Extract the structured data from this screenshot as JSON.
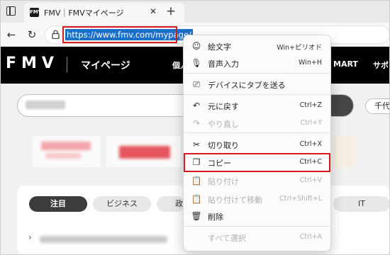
{
  "browser": {
    "tab": {
      "favicon_text": "FMV",
      "title": "FMV｜FMVマイページ",
      "close": "✕"
    },
    "new_tab": "+",
    "nav": {
      "back": "←",
      "reload": "↻"
    },
    "address": {
      "url": "https://www.fmv.com/mypage/"
    }
  },
  "page": {
    "logo": "FMV",
    "title": "マイページ",
    "nav": [
      "個人",
      "MART",
      "サポ"
    ],
    "location_chip": "千代",
    "tabs": [
      "注目",
      "ビジネス",
      "政",
      "IT"
    ],
    "list_chevron": "›"
  },
  "context_menu": {
    "items": [
      {
        "icon": "emoji-icon",
        "glyph": "☺",
        "label": "絵文字",
        "shortcut": "Win+ピリオド",
        "disabled": false
      },
      {
        "icon": "microphone-icon",
        "glyph": "🎙",
        "label": "音声入力",
        "shortcut": "Win+H",
        "disabled": false
      },
      {
        "icon": "send-to-device-icon",
        "glyph": "⎚",
        "label": "デバイスにタブを送る",
        "shortcut": "",
        "disabled": false
      },
      {
        "icon": "undo-icon",
        "glyph": "↶",
        "label": "元に戻す",
        "shortcut": "Ctrl+Z",
        "disabled": false
      },
      {
        "icon": "redo-icon",
        "glyph": "↷",
        "label": "やり直し",
        "shortcut": "Ctrl+Y",
        "disabled": true
      },
      {
        "icon": "cut-icon",
        "glyph": "✂",
        "label": "切り取り",
        "shortcut": "Ctrl+X",
        "disabled": false
      },
      {
        "icon": "copy-icon",
        "glyph": "❐",
        "label": "コピー",
        "shortcut": "Ctrl+C",
        "disabled": false
      },
      {
        "icon": "paste-icon",
        "glyph": "📋",
        "label": "貼り付け",
        "shortcut": "Ctrl+V",
        "disabled": true
      },
      {
        "icon": "paste-and-go-icon",
        "glyph": "📋",
        "label": "貼り付けて移動",
        "shortcut": "Ctrl+Shift+L",
        "disabled": true
      },
      {
        "icon": "delete-icon",
        "glyph": "🗑",
        "label": "削除",
        "shortcut": "",
        "disabled": false
      },
      {
        "icon": "",
        "glyph": "",
        "label": "すべて選択",
        "shortcut": "Ctrl+A",
        "disabled": true
      }
    ]
  },
  "colors": {
    "highlight": "#d71920",
    "selection": "#1a6fc9",
    "header": "#000000"
  }
}
